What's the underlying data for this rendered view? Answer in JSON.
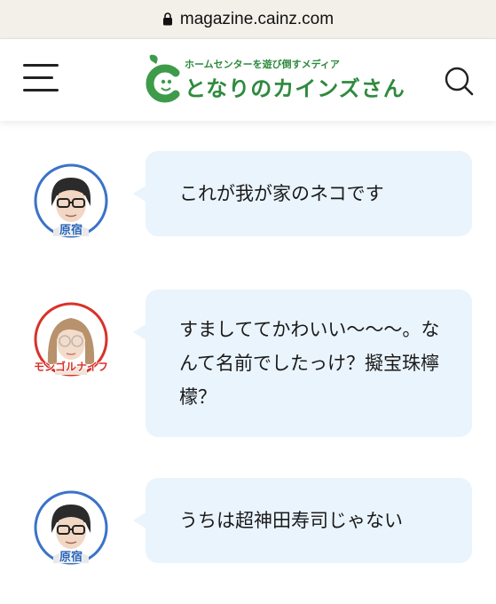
{
  "browser": {
    "url": "magazine.cainz.com",
    "lock_icon": "lock-icon"
  },
  "header": {
    "menu_icon": "hamburger-menu-icon",
    "logo": {
      "tagline": "ホームセンターを遊び倒すメディア",
      "brand": "となりのカインズさん"
    },
    "search_icon": "search-icon"
  },
  "messages": [
    {
      "speaker": "原宿",
      "speaker_color": "#2a63b8",
      "text": "これが我が家のネコです"
    },
    {
      "speaker": "モンゴルナイフ",
      "speaker_color": "#d8322a",
      "text": "すましててかわいい〜〜〜。なんて名前でしたっけ？擬宝珠檸檬？"
    },
    {
      "speaker": "原宿",
      "speaker_color": "#2a63b8",
      "text": "うちは超神田寿司じゃない"
    }
  ],
  "colors": {
    "url_bar": "#f3efe9",
    "brand_green": "#2f8a3e",
    "bubble": "#eaf4fd",
    "blue_ring": "#3a73c9",
    "red_ring": "#d8322a"
  }
}
